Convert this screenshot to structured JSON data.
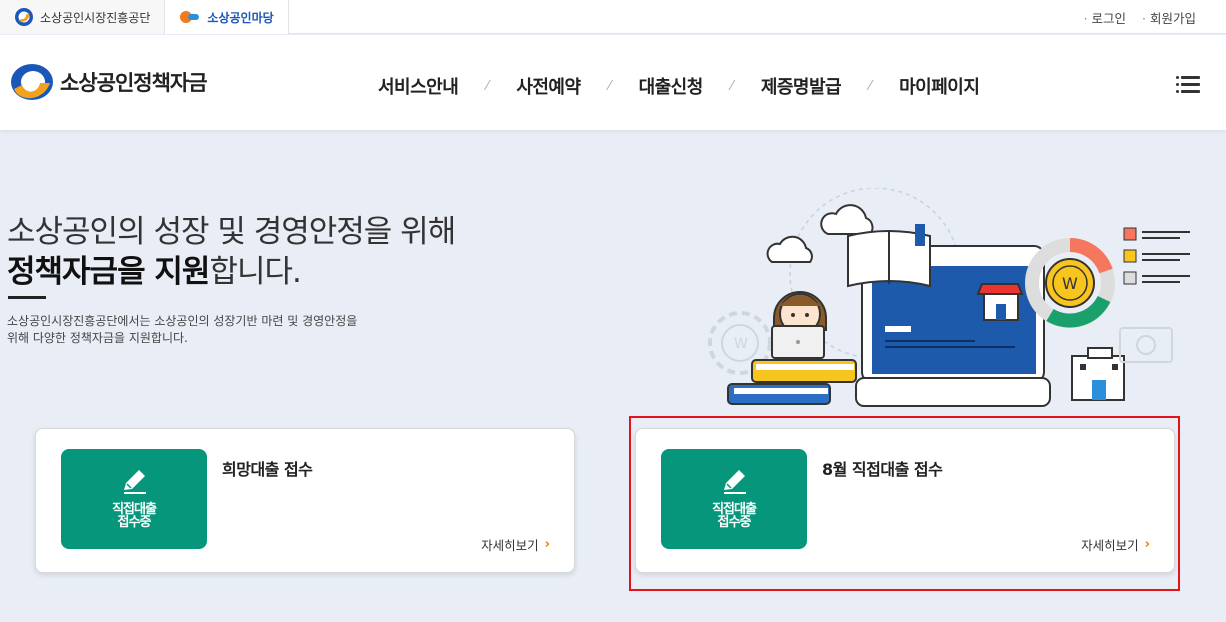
{
  "topbar": {
    "family_sites": [
      {
        "label": "소상공인시장진흥공단"
      },
      {
        "label": "소상공인마당"
      }
    ],
    "util_links": [
      {
        "label": "로그인"
      },
      {
        "label": "회원가입"
      }
    ]
  },
  "header": {
    "logo_text": "소상공인정책자금",
    "nav": [
      {
        "label": "서비스안내"
      },
      {
        "label": "사전예약"
      },
      {
        "label": "대출신청"
      },
      {
        "label": "제증명발급"
      },
      {
        "label": "마이페이지"
      }
    ],
    "separator": "⁄",
    "menu_icon": "hamburger-icon"
  },
  "hero": {
    "title_line1": "소상공인의 성장 및 경영안정을 위해",
    "title_bold": "정책자금을 지원",
    "title_rest": "합니다.",
    "description": "소상공인시장진흥공단에서는 소상공인의 성장기반 마련 및 경영안정을 위해 다양한 정책자금을 지원합니다."
  },
  "cards": [
    {
      "badge_line1": "직접대출",
      "badge_line2": "접수중",
      "title": "희망대출 접수",
      "more": "자세히보기",
      "arrow": "›"
    },
    {
      "badge_line1": "직접대출",
      "badge_line2": "접수중",
      "title": "8월 직접대출 접수",
      "more": "자세히보기",
      "arrow": "›"
    }
  ],
  "colors": {
    "badge": "#06967b",
    "highlight": "#e3131b",
    "arrow": "#e07b00",
    "background": "#e9eef6"
  }
}
